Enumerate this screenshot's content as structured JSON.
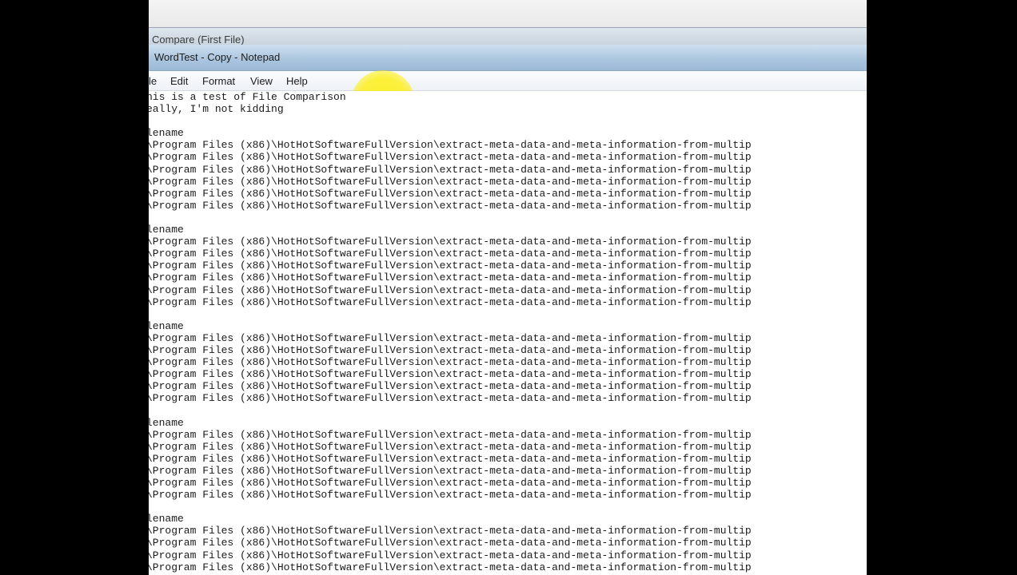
{
  "back_window": {
    "title": "Compare  (First File)"
  },
  "window": {
    "title": "WordTest - Copy - Notepad"
  },
  "menu": [
    "le",
    "Edit",
    "Format",
    "View",
    "Help"
  ],
  "document": {
    "text": "nis is a test of File Comparison\neally, I'm not kidding\n\nlename\n\\Program Files (x86)\\HotHotSoftwareFullVersion\\extract-meta-data-and-meta-information-from-multip\n\\Program Files (x86)\\HotHotSoftwareFullVersion\\extract-meta-data-and-meta-information-from-multip\n\\Program Files (x86)\\HotHotSoftwareFullVersion\\extract-meta-data-and-meta-information-from-multip\n\\Program Files (x86)\\HotHotSoftwareFullVersion\\extract-meta-data-and-meta-information-from-multip\n\\Program Files (x86)\\HotHotSoftwareFullVersion\\extract-meta-data-and-meta-information-from-multip\n\\Program Files (x86)\\HotHotSoftwareFullVersion\\extract-meta-data-and-meta-information-from-multip\n\nlename\n\\Program Files (x86)\\HotHotSoftwareFullVersion\\extract-meta-data-and-meta-information-from-multip\n\\Program Files (x86)\\HotHotSoftwareFullVersion\\extract-meta-data-and-meta-information-from-multip\n\\Program Files (x86)\\HotHotSoftwareFullVersion\\extract-meta-data-and-meta-information-from-multip\n\\Program Files (x86)\\HotHotSoftwareFullVersion\\extract-meta-data-and-meta-information-from-multip\n\\Program Files (x86)\\HotHotSoftwareFullVersion\\extract-meta-data-and-meta-information-from-multip\n\\Program Files (x86)\\HotHotSoftwareFullVersion\\extract-meta-data-and-meta-information-from-multip\n\nlename\n\\Program Files (x86)\\HotHotSoftwareFullVersion\\extract-meta-data-and-meta-information-from-multip\n\\Program Files (x86)\\HotHotSoftwareFullVersion\\extract-meta-data-and-meta-information-from-multip\n\\Program Files (x86)\\HotHotSoftwareFullVersion\\extract-meta-data-and-meta-information-from-multip\n\\Program Files (x86)\\HotHotSoftwareFullVersion\\extract-meta-data-and-meta-information-from-multip\n\\Program Files (x86)\\HotHotSoftwareFullVersion\\extract-meta-data-and-meta-information-from-multip\n\\Program Files (x86)\\HotHotSoftwareFullVersion\\extract-meta-data-and-meta-information-from-multip\n\nlename\n\\Program Files (x86)\\HotHotSoftwareFullVersion\\extract-meta-data-and-meta-information-from-multip\n\\Program Files (x86)\\HotHotSoftwareFullVersion\\extract-meta-data-and-meta-information-from-multip\n\\Program Files (x86)\\HotHotSoftwareFullVersion\\extract-meta-data-and-meta-information-from-multip\n\\Program Files (x86)\\HotHotSoftwareFullVersion\\extract-meta-data-and-meta-information-from-multip\n\\Program Files (x86)\\HotHotSoftwareFullVersion\\extract-meta-data-and-meta-information-from-multip\n\\Program Files (x86)\\HotHotSoftwareFullVersion\\extract-meta-data-and-meta-information-from-multip\n\nlename\n\\Program Files (x86)\\HotHotSoftwareFullVersion\\extract-meta-data-and-meta-information-from-multip\n\\Program Files (x86)\\HotHotSoftwareFullVersion\\extract-meta-data-and-meta-information-from-multip\n\\Program Files (x86)\\HotHotSoftwareFullVersion\\extract-meta-data-and-meta-information-from-multip\n\\Program Files (x86)\\HotHotSoftwareFullVersion\\extract-meta-data-and-meta-information-from-multip"
  }
}
